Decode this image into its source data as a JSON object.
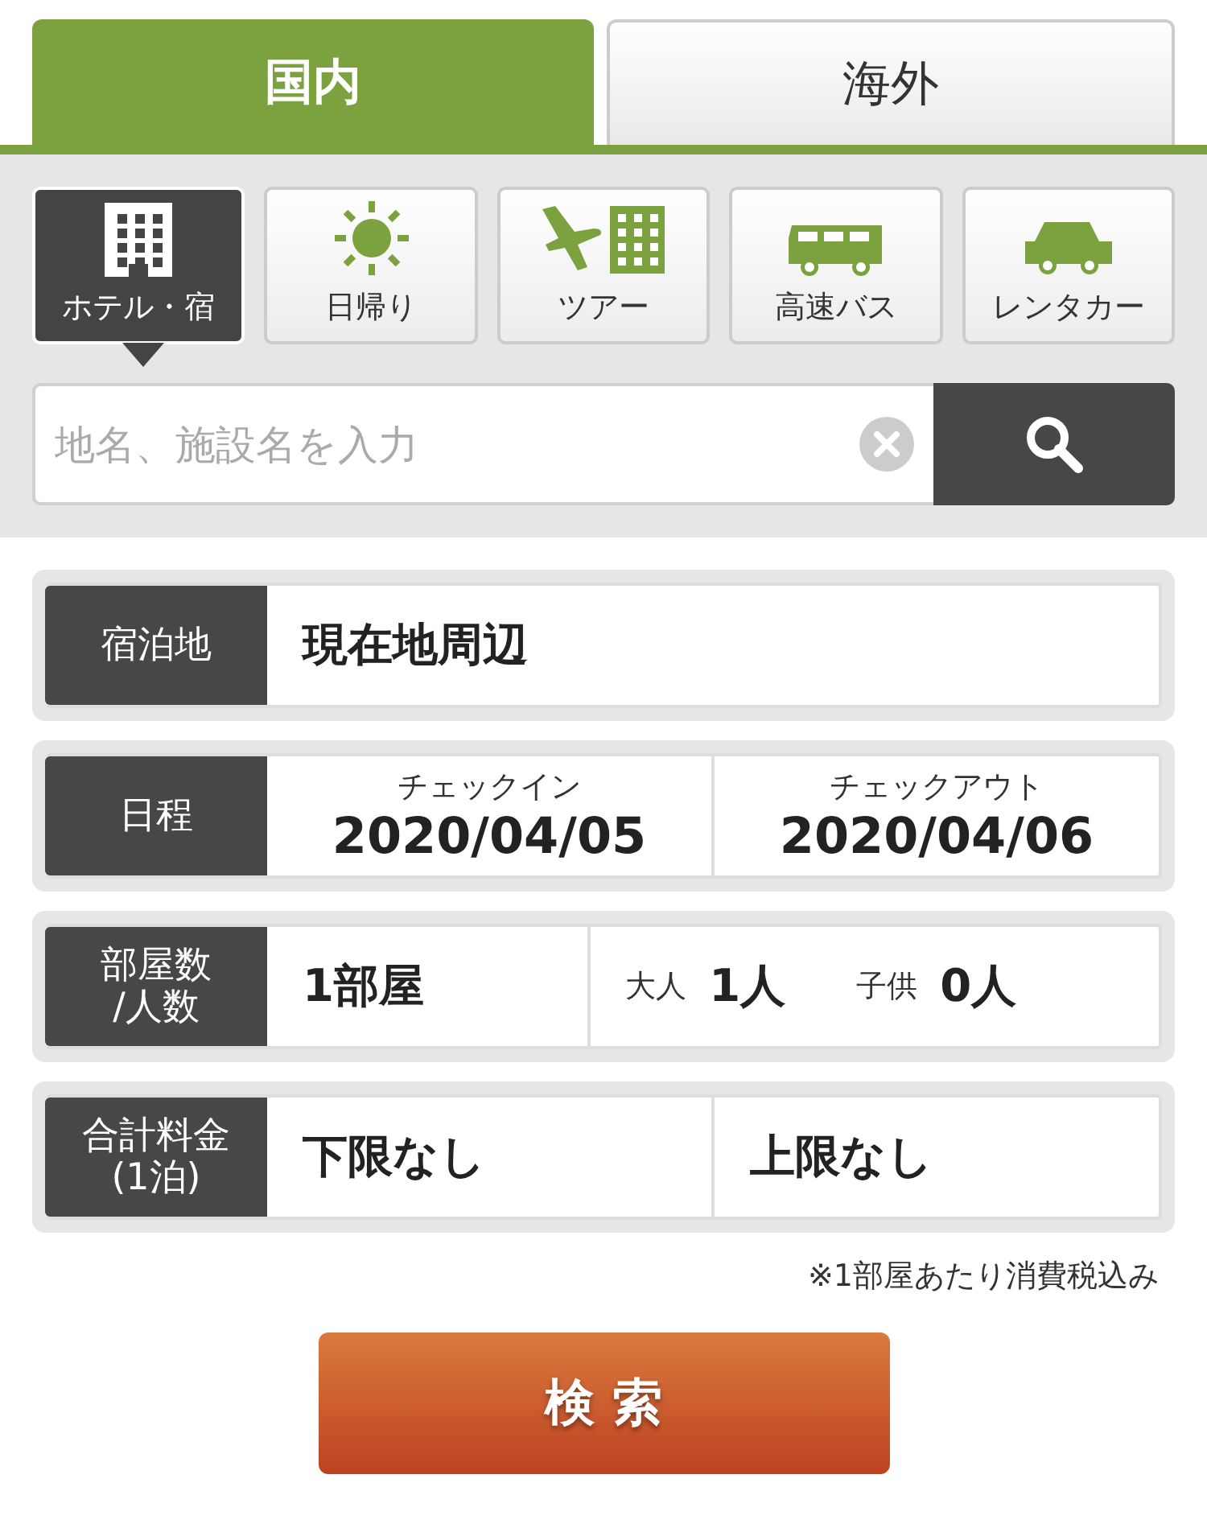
{
  "tabs": [
    {
      "label": "国内",
      "selected": true
    },
    {
      "label": "海外",
      "selected": false
    }
  ],
  "categories": [
    {
      "label": "ホテル・宿",
      "kind": "building",
      "selected": true
    },
    {
      "label": "日帰り",
      "kind": "sun",
      "selected": false
    },
    {
      "label": "ツアー",
      "kind": "tour",
      "selected": false
    },
    {
      "label": "高速バス",
      "kind": "bus",
      "selected": false
    },
    {
      "label": "レンタカー",
      "kind": "car",
      "selected": false
    }
  ],
  "search": {
    "placeholder": "地名、施設名を入力"
  },
  "form": [
    {
      "kind": "single",
      "label": "宿泊地",
      "value": "現在地周辺"
    },
    {
      "kind": "dates",
      "label": "日程",
      "checkin_label": "チェックイン",
      "checkin": "2020/04/05",
      "checkout_label": "チェックアウト",
      "checkout": "2020/04/06"
    },
    {
      "kind": "guests",
      "label": "部屋数\n/人数",
      "rooms": "1部屋",
      "adults_label": "大人",
      "adults": "1人",
      "children_label": "子供",
      "children": "0人"
    },
    {
      "kind": "range",
      "label": "合計料金\n(1泊)",
      "min": "下限なし",
      "max": "上限なし"
    }
  ],
  "note": "※1部屋あたり消費税込み",
  "submit": "検 索"
}
